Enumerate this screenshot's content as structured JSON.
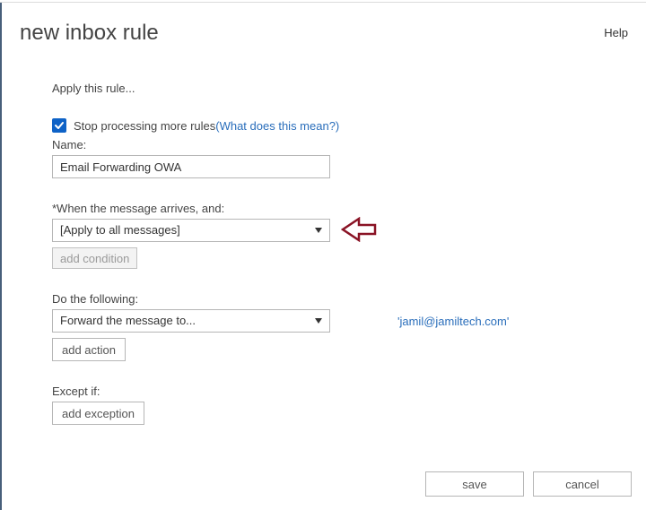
{
  "header": {
    "title": "new inbox rule",
    "help": "Help"
  },
  "intro": "Apply this rule...",
  "stopProcessing": {
    "checked": true,
    "label": "Stop processing more rules ",
    "linkText": "(What does this mean?)"
  },
  "nameLabel": "Name:",
  "nameValue": "Email Forwarding OWA",
  "when": {
    "label": "*When the message arrives, and:",
    "selected": "[Apply to all messages]",
    "addCondition": "add condition"
  },
  "doFollowing": {
    "label": "Do the following:",
    "selected": "Forward the message to...",
    "recipient": "'jamil@jamiltech.com'",
    "addAction": "add action"
  },
  "except": {
    "label": "Except if:",
    "addException": "add exception"
  },
  "footer": {
    "save": "save",
    "cancel": "cancel"
  }
}
